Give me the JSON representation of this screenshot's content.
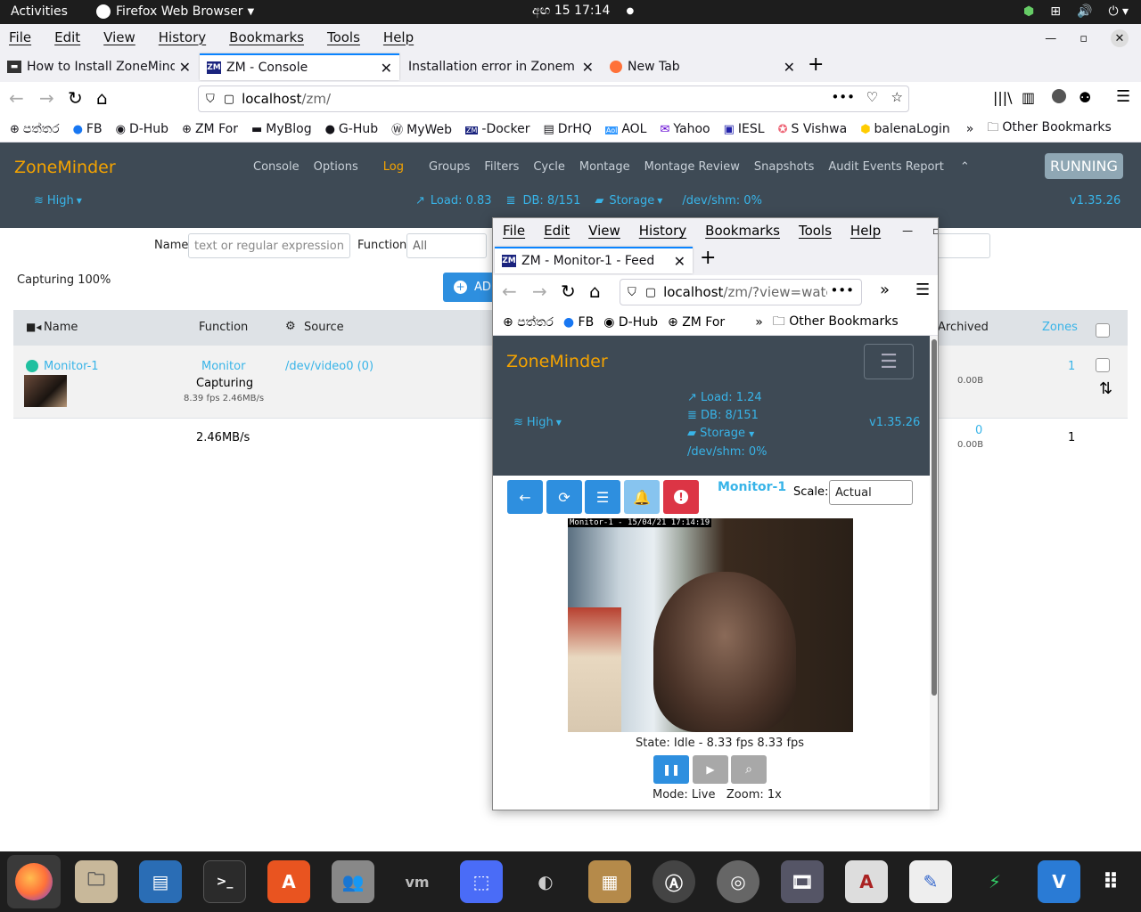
{
  "gnome": {
    "activities": "Activities",
    "app": "Firefox Web Browser",
    "clock": "අඟ  15  17:14"
  },
  "menu": [
    "File",
    "Edit",
    "View",
    "History",
    "Bookmarks",
    "Tools",
    "Help"
  ],
  "tabs": [
    {
      "label": "How to Install ZoneMinder"
    },
    {
      "label": "ZM - Console"
    },
    {
      "label": "Installation error in Zoneminder"
    },
    {
      "label": "New Tab"
    }
  ],
  "url": {
    "host": "localhost",
    "path": "/zm/"
  },
  "bookmarks": [
    "පත්තර",
    "FB",
    "D-Hub",
    "ZM For",
    "MyBlog",
    "G-Hub",
    "MyWeb",
    "-Docker",
    "DrHQ",
    "AOL",
    "Yahoo",
    "IESL",
    "S Vishwa",
    "balenaLogin"
  ],
  "other_bookmarks": "Other Bookmarks",
  "zm": {
    "logo": "ZoneMinder",
    "nav": [
      "Console",
      "Options",
      "Log",
      "Groups",
      "Filters",
      "Cycle",
      "Montage",
      "Montage Review",
      "Snapshots",
      "Audit Events Report"
    ],
    "running": "RUNNING",
    "bandwidth": "High",
    "load": "Load: 0.83",
    "db": "DB: 8/151",
    "storage": "Storage",
    "shm": "/dev/shm: 0%",
    "version": "v1.35.26",
    "filter_name_label": "Name",
    "filter_name_placeholder": "text or regular expression",
    "filter_function_label": "Function",
    "filter_function_value": "All",
    "capturing": "Capturing 100%",
    "add_label": "AD",
    "cols": {
      "name": "Name",
      "function": "Function",
      "source": "Source",
      "archived": "Archived",
      "zones": "Zones"
    },
    "row": {
      "name": "Monitor-1",
      "function": "Monitor",
      "state": "Capturing",
      "fps": "8.39 fps 2.46MB/s",
      "source": "/dev/video0 (0)",
      "archived": "0.00B",
      "zones": "1"
    },
    "totals": {
      "bandwidth": "2.46MB/s",
      "archived_count": "0",
      "archived": "0.00B",
      "zones": "1"
    }
  },
  "popup": {
    "menu": [
      "File",
      "Edit",
      "View",
      "History",
      "Bookmarks",
      "Tools",
      "Help"
    ],
    "tab": "ZM - Monitor-1 - Feed",
    "url_host": "localhost",
    "url_path": "/zm/?view=watch",
    "bookmarks": [
      "පත්තර",
      "FB",
      "D-Hub",
      "ZM For"
    ],
    "other_bookmarks": "Other Bookmarks",
    "logo": "ZoneMinder",
    "load": "Load: 1.24",
    "db": "DB: 8/151",
    "storage": "Storage",
    "shm": "/dev/shm: 0%",
    "bandwidth": "High",
    "version": "v1.35.26",
    "monitor": "Monitor-1",
    "scale_label": "Scale:",
    "scale_value": "Actual",
    "overlay": "Monitor-1 - 15/04/21 17:14:19",
    "state": "State: Idle - 8.33 fps 8.33 fps",
    "mode": "Mode: Live   Zoom: 1x"
  },
  "colors": {
    "zm_bg": "#3e4a55",
    "zm_orange": "#f4a300",
    "zm_cyan": "#38b4e8",
    "btn_blue": "#2e8fdf",
    "btn_red": "#dc3545"
  }
}
